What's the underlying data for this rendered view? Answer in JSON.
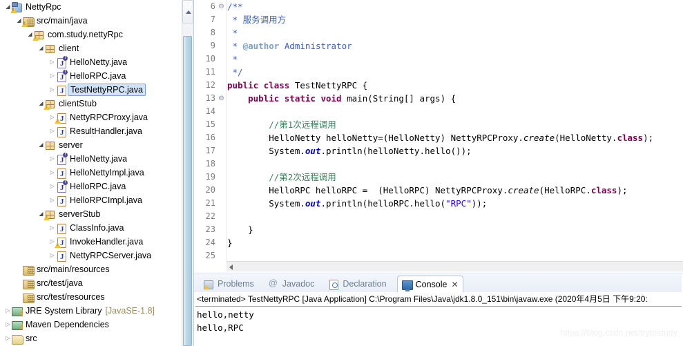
{
  "explorer": {
    "name": "package-explorer",
    "items": [
      {
        "label": "NettyRpc",
        "indent": 0,
        "twisty": "open",
        "icon": "project-icon",
        "warn": true,
        "selected": false
      },
      {
        "label": "src/main/java",
        "indent": 1,
        "twisty": "open",
        "icon": "source-folder-icon",
        "warn": true,
        "selected": false
      },
      {
        "label": "com.study.nettyRpc",
        "indent": 2,
        "twisty": "open",
        "icon": "package-icon",
        "warn": true,
        "selected": false
      },
      {
        "label": "client",
        "indent": 3,
        "twisty": "open",
        "icon": "package-icon",
        "warn": false,
        "selected": false
      },
      {
        "label": "HelloNetty.java",
        "indent": 4,
        "twisty": "closed",
        "icon": "java-interface-icon",
        "warn": false,
        "selected": false
      },
      {
        "label": "HelloRPC.java",
        "indent": 4,
        "twisty": "closed",
        "icon": "java-interface-icon",
        "warn": false,
        "selected": false
      },
      {
        "label": "TestNettyRPC.java",
        "indent": 4,
        "twisty": "closed",
        "icon": "java-class-icon",
        "warn": false,
        "selected": true
      },
      {
        "label": "clientStub",
        "indent": 3,
        "twisty": "open",
        "icon": "package-icon",
        "warn": true,
        "selected": false
      },
      {
        "label": "NettyRPCProxy.java",
        "indent": 4,
        "twisty": "closed",
        "icon": "java-class-icon",
        "warn": true,
        "selected": false
      },
      {
        "label": "ResultHandler.java",
        "indent": 4,
        "twisty": "closed",
        "icon": "java-class-icon",
        "warn": false,
        "selected": false
      },
      {
        "label": "server",
        "indent": 3,
        "twisty": "open",
        "icon": "package-icon",
        "warn": false,
        "selected": false
      },
      {
        "label": "HelloNetty.java",
        "indent": 4,
        "twisty": "closed",
        "icon": "java-interface-icon",
        "warn": false,
        "selected": false
      },
      {
        "label": "HelloNettyImpl.java",
        "indent": 4,
        "twisty": "closed",
        "icon": "java-class-icon",
        "warn": false,
        "selected": false
      },
      {
        "label": "HelloRPC.java",
        "indent": 4,
        "twisty": "closed",
        "icon": "java-interface-icon",
        "warn": false,
        "selected": false
      },
      {
        "label": "HelloRPCImpl.java",
        "indent": 4,
        "twisty": "closed",
        "icon": "java-class-icon",
        "warn": false,
        "selected": false
      },
      {
        "label": "serverStub",
        "indent": 3,
        "twisty": "open",
        "icon": "package-icon",
        "warn": true,
        "selected": false
      },
      {
        "label": "ClassInfo.java",
        "indent": 4,
        "twisty": "closed",
        "icon": "java-class-icon",
        "warn": false,
        "selected": false
      },
      {
        "label": "InvokeHandler.java",
        "indent": 4,
        "twisty": "closed",
        "icon": "java-class-icon",
        "warn": true,
        "selected": false
      },
      {
        "label": "NettyRPCServer.java",
        "indent": 4,
        "twisty": "closed",
        "icon": "java-class-icon",
        "warn": false,
        "selected": false
      },
      {
        "label": "src/main/resources",
        "indent": 1,
        "twisty": "none",
        "icon": "source-folder-icon",
        "warn": false,
        "selected": false
      },
      {
        "label": "src/test/java",
        "indent": 1,
        "twisty": "none",
        "icon": "source-folder-icon",
        "warn": false,
        "selected": false
      },
      {
        "label": "src/test/resources",
        "indent": 1,
        "twisty": "none",
        "icon": "source-folder-icon",
        "warn": false,
        "selected": false
      },
      {
        "label": "JRE System Library",
        "suffix": "[JavaSE-1.8]",
        "indent": 0,
        "twisty": "closed",
        "icon": "library-icon",
        "warn": false,
        "selected": false
      },
      {
        "label": "Maven Dependencies",
        "indent": 0,
        "twisty": "closed",
        "icon": "library-icon",
        "warn": false,
        "selected": false
      },
      {
        "label": "src",
        "indent": 0,
        "twisty": "closed",
        "icon": "folder-icon",
        "warn": false,
        "selected": false
      }
    ]
  },
  "editor": {
    "name": "java-editor",
    "first_line": 6,
    "lines": [
      {
        "n": 6,
        "fold": "collapse"
      },
      {
        "n": 7,
        "fold": ""
      },
      {
        "n": 8,
        "fold": ""
      },
      {
        "n": 9,
        "fold": ""
      },
      {
        "n": 10,
        "fold": ""
      },
      {
        "n": 11,
        "fold": ""
      },
      {
        "n": 12,
        "fold": ""
      },
      {
        "n": 13,
        "fold": "collapse"
      },
      {
        "n": 14,
        "fold": ""
      },
      {
        "n": 15,
        "fold": ""
      },
      {
        "n": 16,
        "fold": ""
      },
      {
        "n": 17,
        "fold": ""
      },
      {
        "n": 18,
        "fold": ""
      },
      {
        "n": 19,
        "fold": ""
      },
      {
        "n": 20,
        "fold": ""
      },
      {
        "n": 21,
        "fold": ""
      },
      {
        "n": 22,
        "fold": ""
      },
      {
        "n": 23,
        "fold": ""
      },
      {
        "n": 24,
        "fold": ""
      },
      {
        "n": 25,
        "fold": ""
      }
    ],
    "code_plain": [
      "/**",
      " * 服务调用方",
      " * ",
      " * @author Administrator",
      " * ",
      " */",
      "public class TestNettyRPC {",
      "    public static void main(String[] args) {",
      "",
      "        //第1次远程调用",
      "        HelloNetty helloNetty=(HelloNetty) NettyRPCProxy.create(HelloNetty.class);",
      "        System.out.println(helloNetty.hello());",
      "",
      "        //第2次远程调用",
      "        HelloRPC helloRPC =  (HelloRPC) NettyRPCProxy.create(HelloRPC.class);",
      "        System.out.println(helloRPC.hello(\"RPC\"));",
      "",
      "    }",
      "}",
      ""
    ]
  },
  "bottom_panel": {
    "name": "bottom-view-stack",
    "tabs": [
      {
        "label": "Problems",
        "icon": "problems-icon",
        "active": false,
        "closable": false
      },
      {
        "label": "Javadoc",
        "icon": "javadoc-icon",
        "active": false,
        "closable": false
      },
      {
        "label": "Declaration",
        "icon": "declaration-icon",
        "active": false,
        "closable": false
      },
      {
        "label": "Console",
        "icon": "console-icon",
        "active": true,
        "closable": true,
        "close_glyph": "✕"
      }
    ]
  },
  "console": {
    "name": "console-view",
    "header": "<terminated> TestNettyRPC [Java Application] C:\\Program Files\\Java\\jdk1.8.0_151\\bin\\javaw.exe (2020年4月5日 下午9:20:",
    "output": [
      "hello,netty",
      "hello,RPC"
    ]
  },
  "watermark": {
    "text": "https://blog.csdn.net/trytostudy"
  },
  "colors": {
    "keyword": "#7f0055",
    "javadoc": "#3f5fbf",
    "javadoc_tag": "#7f9fbf",
    "line_comment": "#3f7f5f",
    "string": "#2a00ff",
    "static_field": "#0000c0",
    "selection_bg": "#d4e3f5",
    "selection_border": "#7da2ce",
    "line_number": "#7d7d7d"
  }
}
